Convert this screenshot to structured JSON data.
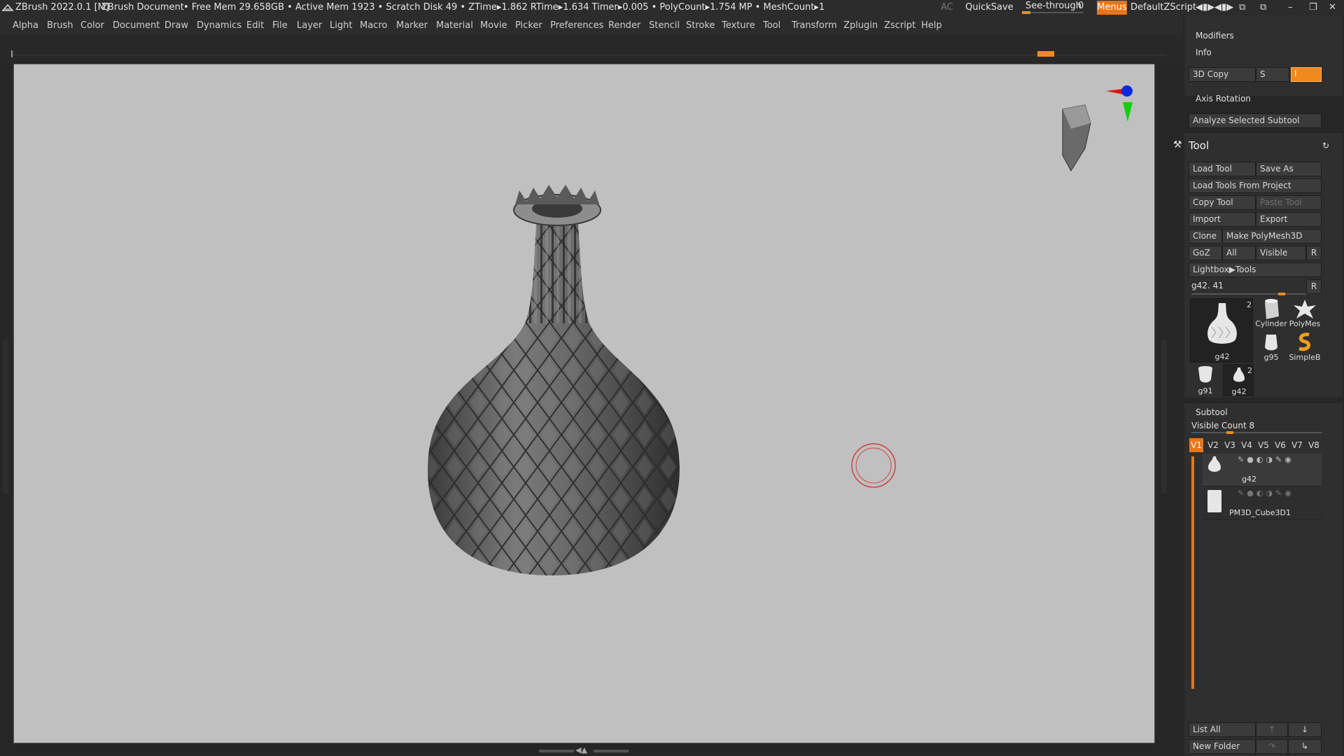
{
  "titlebar": {
    "app": "ZBrush 2022.0.1 [M]",
    "document": "ZBrush Document",
    "stats": "• Free Mem 29.658GB • Active Mem 1923 • Scratch Disk 49 •  ZTime▸1.862 RTime▸1.634 Timer▸0.005 • PolyCount▸1.754 MP  • MeshCount▸1",
    "ac": "AC",
    "quicksave": "QuickSave",
    "seethrough": "See-through",
    "seethrough_value": "0",
    "menus": "Menus",
    "script": "DefaultZScript"
  },
  "menubar": [
    "Alpha",
    "Brush",
    "Color",
    "Document",
    "Draw",
    "Dynamics",
    "Edit",
    "File",
    "Layer",
    "Light",
    "Macro",
    "Marker",
    "Material",
    "Movie",
    "Picker",
    "Preferences",
    "Render",
    "Stencil",
    "Stroke",
    "Texture",
    "Tool",
    "Transform",
    "Zplugin",
    "Zscript",
    "Help"
  ],
  "panel": {
    "modifiers": "Modifiers",
    "info": "Info",
    "copy3d": "3D Copy",
    "copy3d_s": "S",
    "copy3d_value": "I",
    "axis_rotation": "Axis Rotation",
    "analyze": "Analyze Selected Subtool",
    "tool_title": "Tool",
    "load_tool": "Load Tool",
    "save_as": "Save As",
    "load_from_project": "Load Tools From Project",
    "copy_tool": "Copy Tool",
    "paste_tool": "Paste Tool",
    "import": "Import",
    "export": "Export",
    "clone": "Clone",
    "make_polymesh": "Make PolyMesh3D",
    "goz": "GoZ",
    "all": "All",
    "visible": "Visible",
    "r": "R",
    "lightbox_tools": "Lightbox▶Tools",
    "current_tool": "g42. 41",
    "r2": "R",
    "thumbs": [
      {
        "label": "g42",
        "badge": "2"
      },
      {
        "label": "Cylinder"
      },
      {
        "label": "PolyMes"
      },
      {
        "label": "g95"
      },
      {
        "label": "SimpleB"
      },
      {
        "label": "g91"
      },
      {
        "label": "g42",
        "badge": "2"
      }
    ],
    "subtool_title": "Subtool",
    "visible_count": "Visible Count 8",
    "v_buttons": [
      "V1",
      "V2",
      "V3",
      "V4",
      "V5",
      "V6",
      "V7",
      "V8"
    ],
    "subtools": [
      {
        "name": "g42"
      },
      {
        "name": "PM3D_Cube3D1"
      }
    ],
    "list_all": "List All",
    "new_folder": "New Folder"
  },
  "colors": {
    "accent": "#e8761a",
    "canvas": "#c0c0c0",
    "panel_bg": "#262626"
  }
}
